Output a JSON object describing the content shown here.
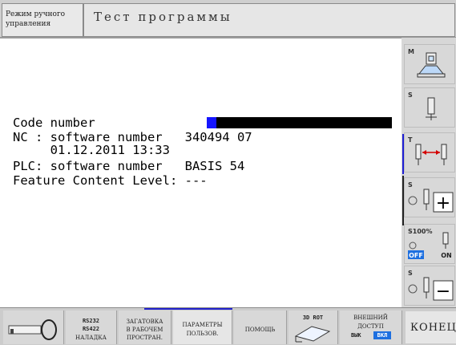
{
  "header": {
    "mode_line1": "Режим ручного",
    "mode_line2": "управления",
    "program_title": "Тест программы"
  },
  "screen": {
    "line1": "Code number",
    "line2": "NC : software number   340494 07",
    "line3": "     01.12.2011 13:33",
    "line4": "PLC: software number   BASIS 54",
    "line5": "Feature Content Level: ---"
  },
  "side_softkeys": [
    {
      "label": "M",
      "icon": "tool-holder-icon"
    },
    {
      "label": "S",
      "icon": "spindle-icon"
    },
    {
      "label": "T",
      "icon": "tool-change-icon"
    },
    {
      "label": "S",
      "icon": "spindle-plus-icon",
      "symbol": "+"
    },
    {
      "label": "S100%",
      "icon": "spindle-override-icon",
      "off": "OFF",
      "on": "ON"
    },
    {
      "label": "S",
      "icon": "spindle-minus-icon",
      "symbol": "−"
    }
  ],
  "bottom_softkeys": {
    "key_icon": "key-icon",
    "rs_line1": "RS232",
    "rs_line2": "RS422",
    "rs_line3": "НАЛАДКА",
    "blank_line1": "ЗАГАТОВКА",
    "blank_line2": "В РАБОЧЕМ",
    "blank_line3": "ПРОСТРАН.",
    "params_line1": "ПАРАМЕТРЫ",
    "params_line2": "ПОЛЬЗОВ.",
    "help": "ПОМОЩЬ",
    "rot": "3D ROT",
    "ext_line1": "ВНЕШНИЙ",
    "ext_line2": "ДОСТУП",
    "ext_off": "ВЫК",
    "ext_on": "ВКЛ",
    "end": "КОНЕЦ"
  },
  "colors": {
    "cursor": "#1515ff",
    "accent": "#2222cc"
  }
}
